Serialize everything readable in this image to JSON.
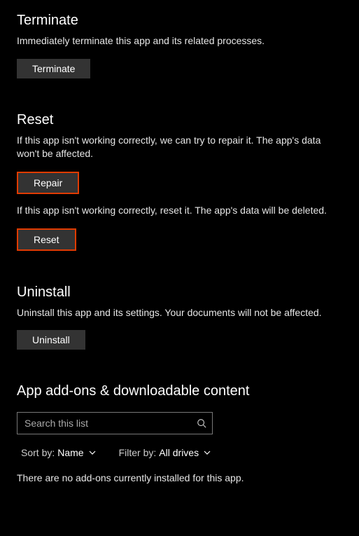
{
  "terminate": {
    "heading": "Terminate",
    "desc": "Immediately terminate this app and its related processes.",
    "button": "Terminate"
  },
  "reset": {
    "heading": "Reset",
    "repair_desc": "If this app isn't working correctly, we can try to repair it. The app's data won't be affected.",
    "repair_button": "Repair",
    "reset_desc": "If this app isn't working correctly, reset it. The app's data will be deleted.",
    "reset_button": "Reset"
  },
  "uninstall": {
    "heading": "Uninstall",
    "desc": "Uninstall this app and its settings. Your documents will not be affected.",
    "button": "Uninstall"
  },
  "addons": {
    "heading": "App add-ons & downloadable content",
    "search_placeholder": "Search this list",
    "sort_label": "Sort by:",
    "sort_value": "Name",
    "filter_label": "Filter by:",
    "filter_value": "All drives",
    "empty": "There are no add-ons currently installed for this app."
  }
}
